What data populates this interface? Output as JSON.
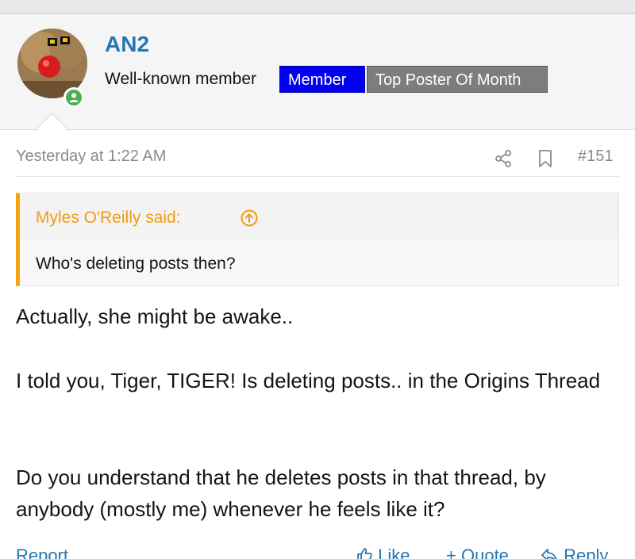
{
  "user": {
    "name": "AN2",
    "title": "Well-known member",
    "badges": [
      "Member",
      "Top Poster Of Month"
    ],
    "online": true,
    "colors": {
      "name": "#2577b1",
      "member_badge": "#0000ee",
      "top_badge": "#7d7d7d",
      "online": "#4caf50"
    }
  },
  "post": {
    "date": "Yesterday at 1:22 AM",
    "number": "#151",
    "quote": {
      "author": "Myles O'Reilly said:",
      "text": "Who's deleting posts then?",
      "accent": "#f7a30f"
    },
    "paragraphs": [
      "Actually, she might be awake..",
      "I told you, Tiger, TIGER! Is deleting posts.. in the Origins Thread",
      "Do you understand that he deletes posts in that thread, by anybody (mostly me) whenever he feels like it?"
    ]
  },
  "actions": {
    "report": "Report",
    "like": "Like",
    "quote": "Quote",
    "reply": "Reply"
  },
  "icons": [
    "share-icon",
    "bookmark-icon",
    "arrow-up-circle-icon",
    "thumbs-up-icon",
    "quote-plus-icon",
    "reply-arrow-icon"
  ]
}
